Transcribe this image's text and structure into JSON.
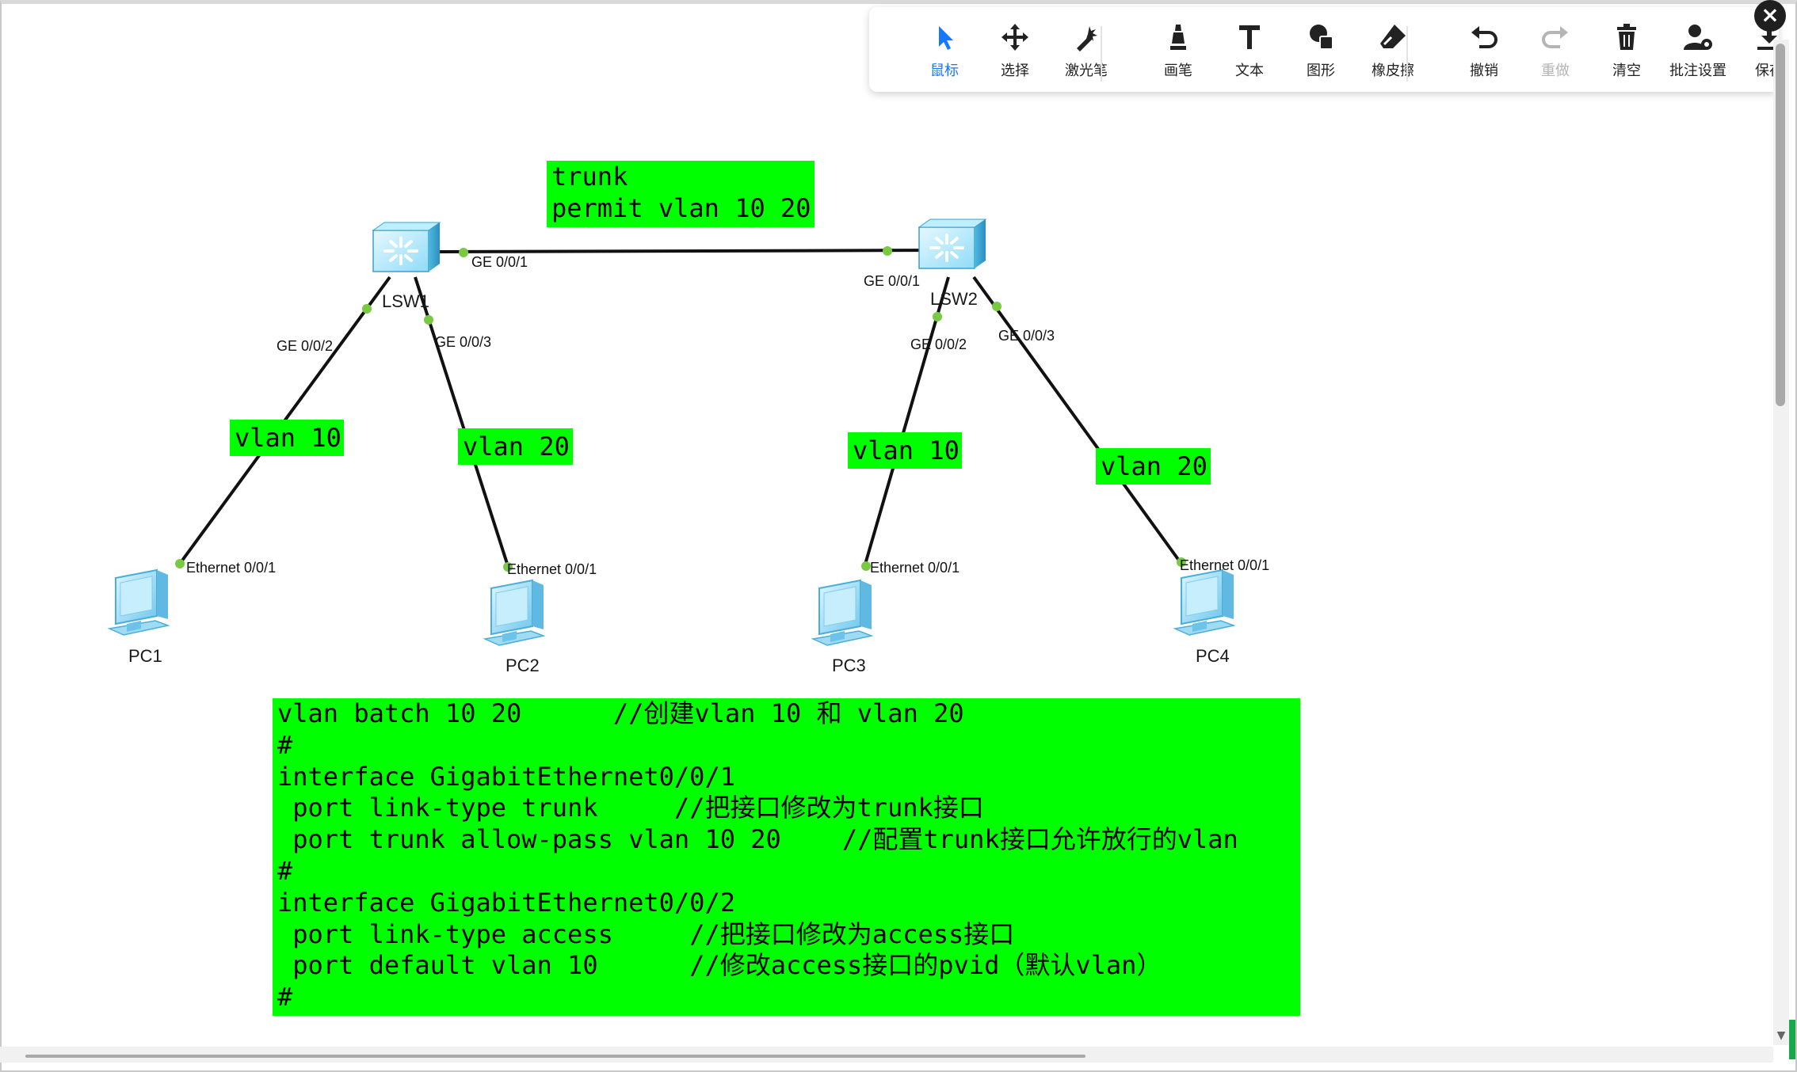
{
  "toolbar": {
    "tools": [
      {
        "label": "鼠标",
        "icon": "cursor-icon",
        "state": "active"
      },
      {
        "label": "选择",
        "icon": "move-icon",
        "state": "normal"
      },
      {
        "label": "激光笔",
        "icon": "laser-pointer-icon",
        "state": "normal"
      },
      {
        "label": "画笔",
        "icon": "pen-icon",
        "state": "normal"
      },
      {
        "label": "文本",
        "icon": "text-icon",
        "state": "normal"
      },
      {
        "label": "图形",
        "icon": "shape-icon",
        "state": "normal"
      },
      {
        "label": "橡皮擦",
        "icon": "eraser-icon",
        "state": "normal"
      },
      {
        "label": "撤销",
        "icon": "undo-icon",
        "state": "normal"
      },
      {
        "label": "重做",
        "icon": "redo-icon",
        "state": "disabled"
      },
      {
        "label": "清空",
        "icon": "trash-icon",
        "state": "normal"
      },
      {
        "label": "批注设置",
        "icon": "annotation-settings-icon",
        "state": "normal"
      },
      {
        "label": "保存",
        "icon": "download-icon",
        "state": "normal"
      }
    ],
    "close_label": "×"
  },
  "colors": {
    "accent": "#1677ff",
    "note_background": "#00ff00",
    "link_dot": "#7ac943",
    "switch_body": "#7fd4f5"
  },
  "topology": {
    "switches": [
      {
        "name": "LSW1"
      },
      {
        "name": "LSW2"
      }
    ],
    "pcs": [
      {
        "name": "PC1"
      },
      {
        "name": "PC2"
      },
      {
        "name": "PC3"
      },
      {
        "name": "PC4"
      }
    ],
    "ports": {
      "lsw1_ge001": "GE 0/0/1",
      "lsw1_ge002": "GE 0/0/2",
      "lsw1_ge003": "GE 0/0/3",
      "lsw2_ge001": "GE 0/0/1",
      "lsw2_ge002": "GE 0/0/2",
      "lsw2_ge003": "GE 0/0/3",
      "pc1_eth": "Ethernet 0/0/1",
      "pc2_eth": "Ethernet 0/0/1",
      "pc3_eth": "Ethernet 0/0/1",
      "pc4_eth": "Ethernet 0/0/1"
    }
  },
  "notes": {
    "trunk": "trunk\npermit vlan 10 20",
    "vlan_pc1": "vlan 10",
    "vlan_pc2": "vlan 20",
    "vlan_pc3": "vlan 10",
    "vlan_pc4": "vlan 20",
    "config": "vlan batch 10 20      //创建vlan 10 和 vlan 20\n#\ninterface GigabitEthernet0/0/1\n port link-type trunk     //把接口修改为trunk接口\n port trunk allow-pass vlan 10 20    //配置trunk接口允许放行的vlan\n#\ninterface GigabitEthernet0/0/2\n port link-type access     //把接口修改为access接口\n port default vlan 10      //修改access接口的pvid（默认vlan）\n#"
  }
}
